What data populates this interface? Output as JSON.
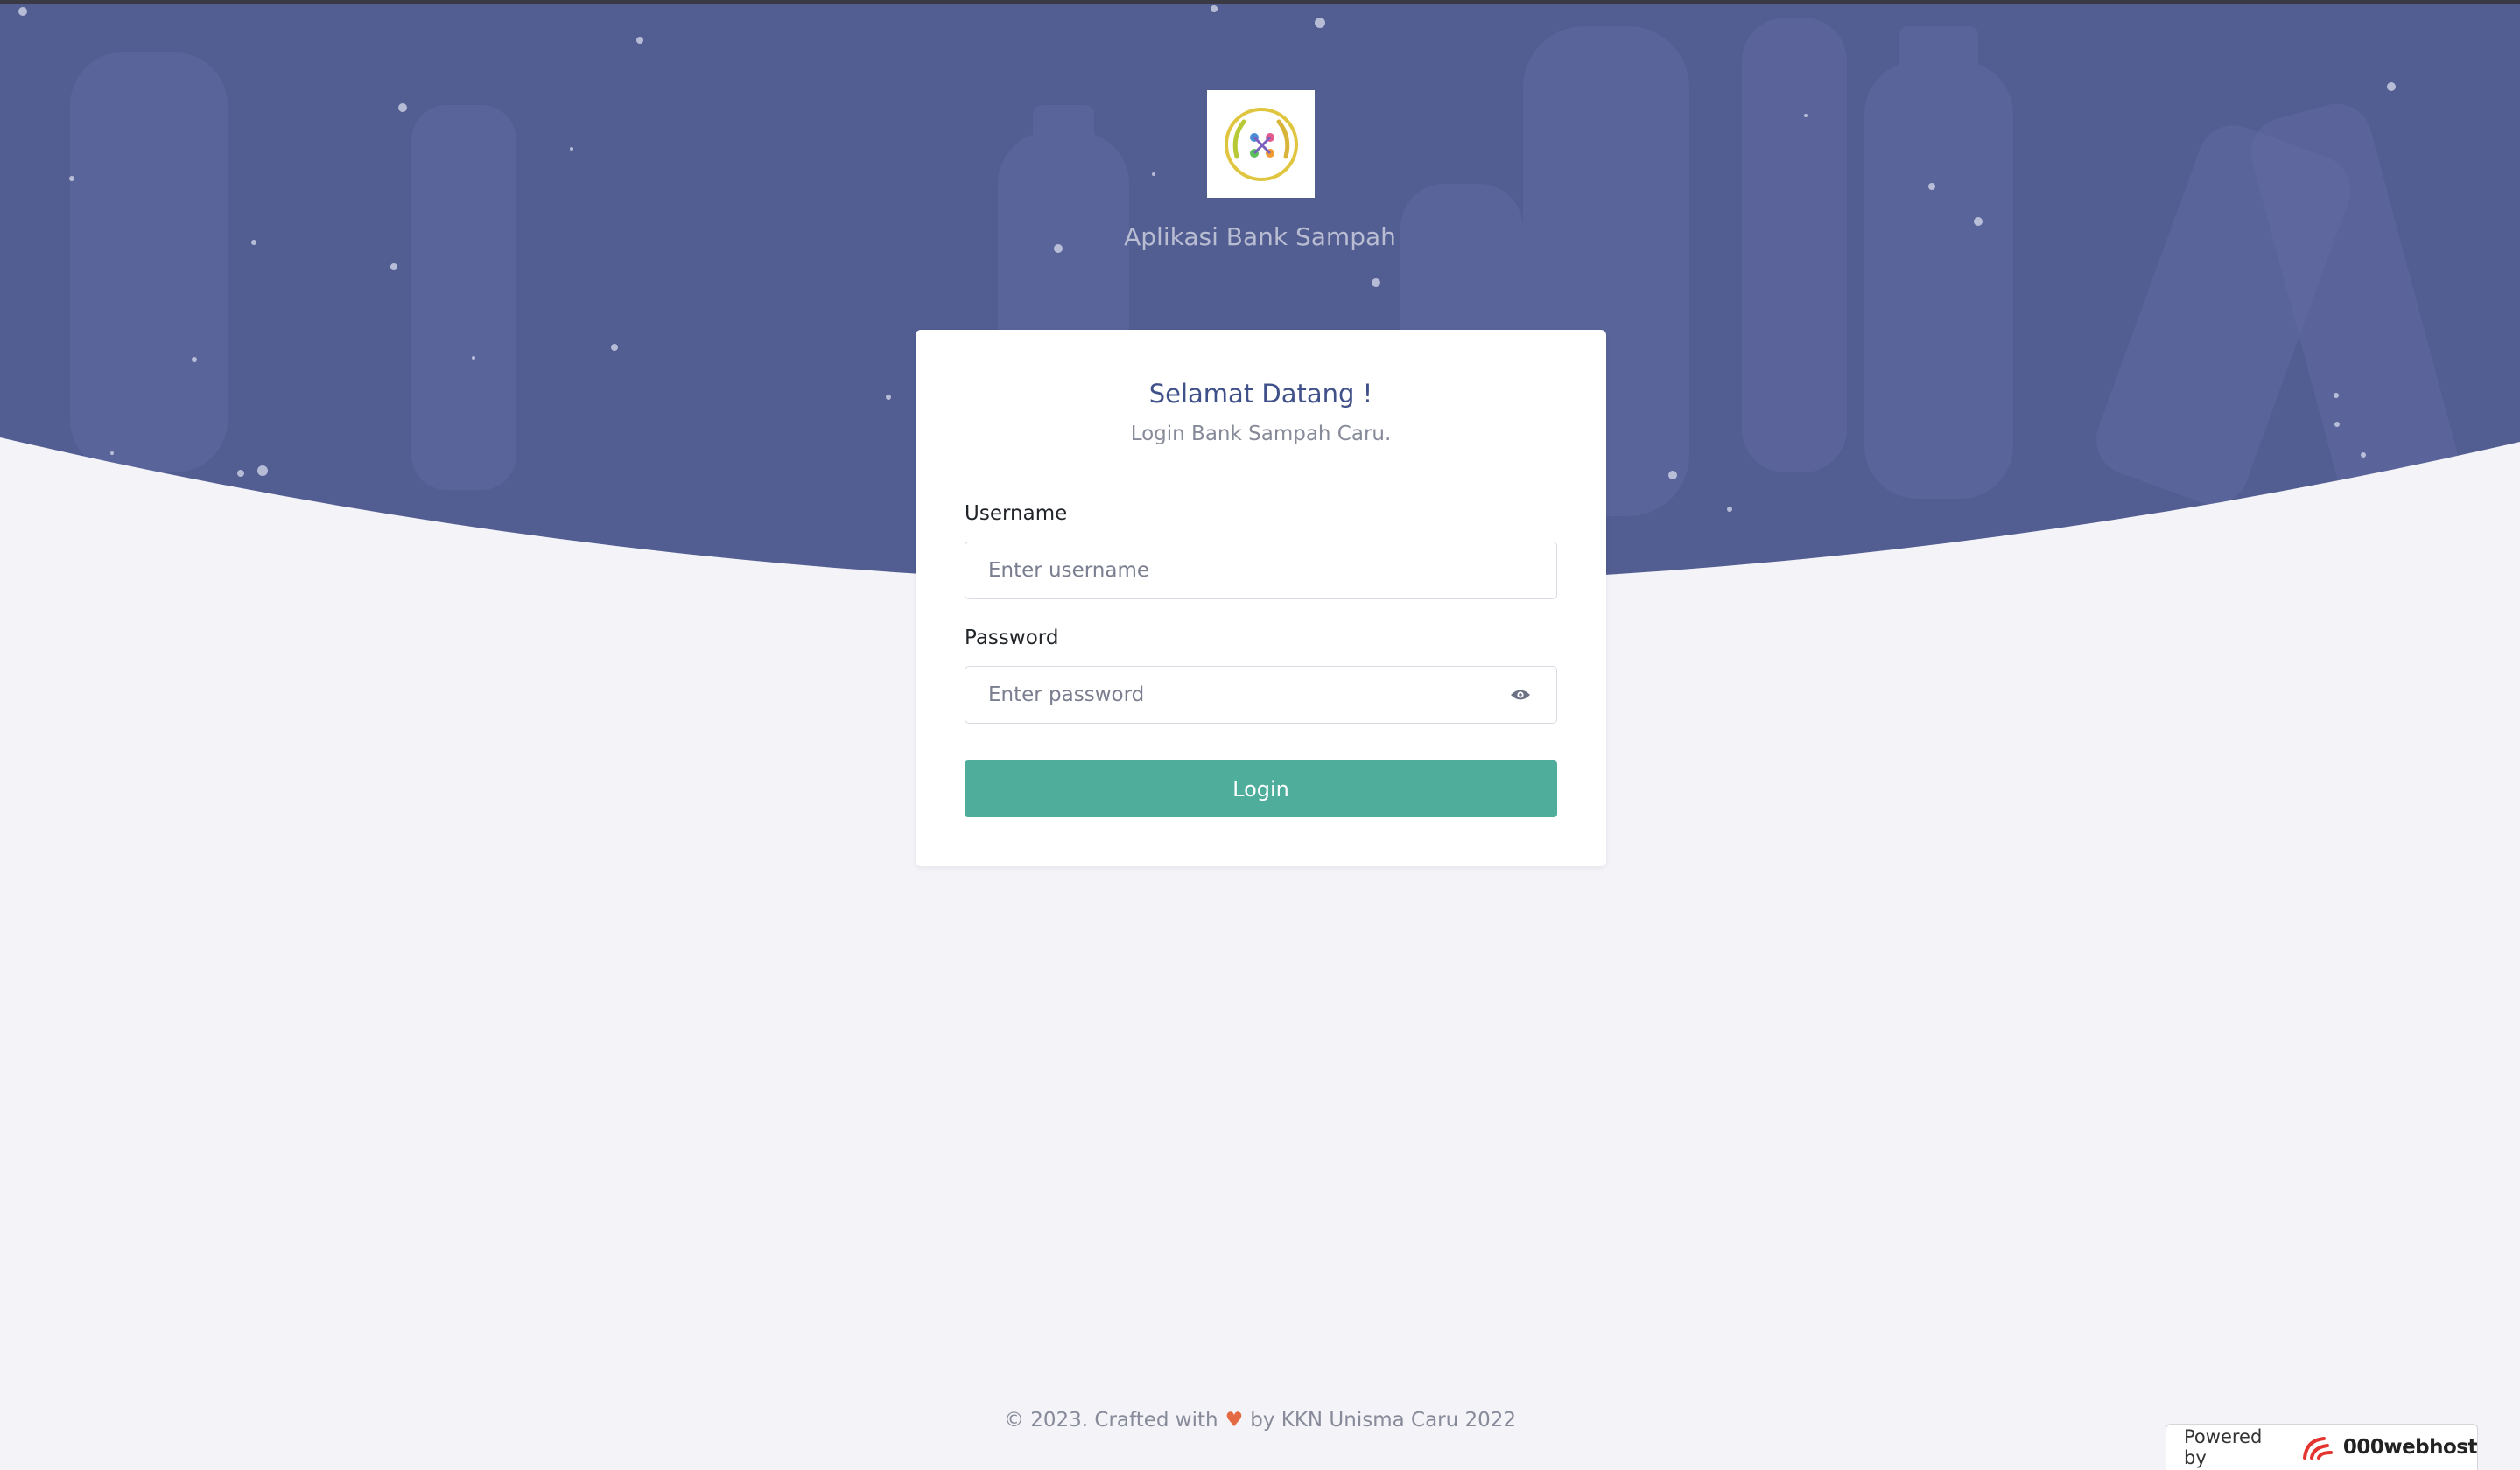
{
  "header": {
    "app_title": "Aplikasi Bank Sampah",
    "logo_icon": "bank-sampah-logo-icon"
  },
  "login_card": {
    "title": "Selamat Datang !",
    "subtitle": "Login Bank Sampah Caru.",
    "username": {
      "label": "Username",
      "value": "",
      "placeholder": "Enter username"
    },
    "password": {
      "label": "Password",
      "value": "",
      "placeholder": "Enter password",
      "toggle_icon": "eye-icon"
    },
    "login_button": "Login"
  },
  "footer": {
    "prefix": "© 2023. Crafted with",
    "heart": "♥",
    "suffix": "by KKN Unisma Caru 2022"
  },
  "powered_badge": {
    "label": "Powered by",
    "brand": "000webhost"
  },
  "colors": {
    "hero_overlay": "#4f5a8e",
    "page_background": "#f3f3f8",
    "card_title": "#405189",
    "login_button": "#4fae9b",
    "heart": "#e36a42"
  }
}
